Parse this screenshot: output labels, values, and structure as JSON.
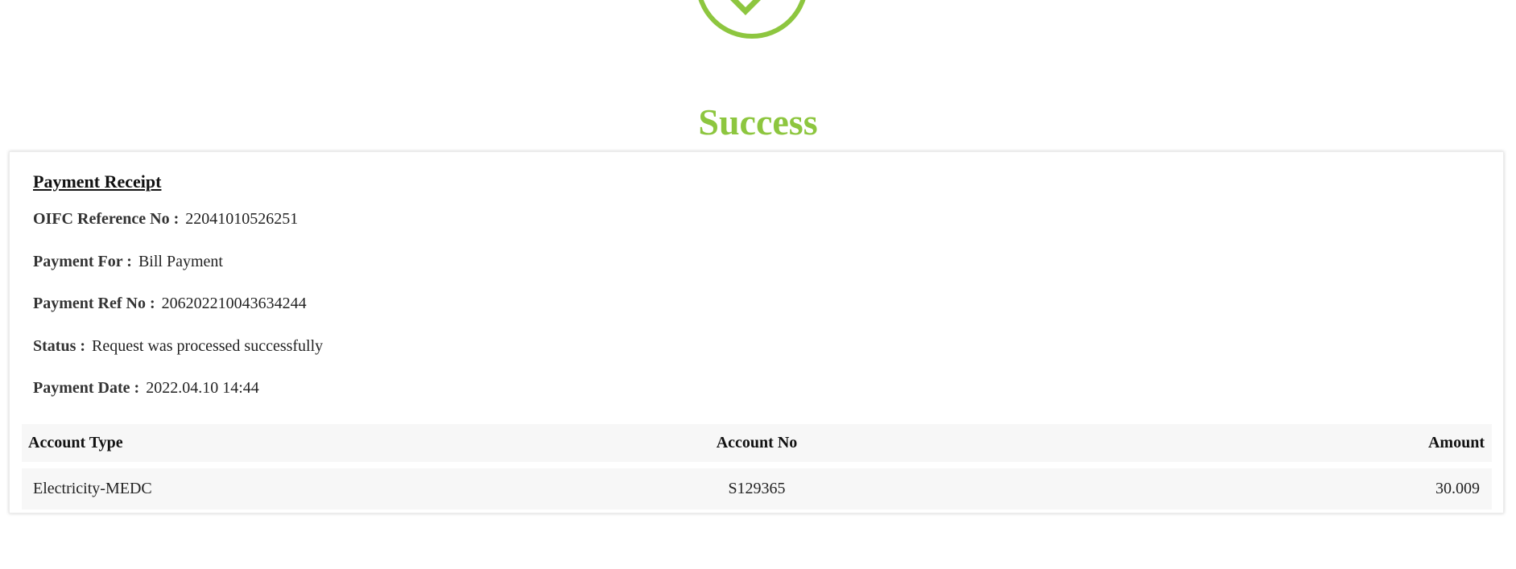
{
  "colors": {
    "accent": "#8dc63f",
    "row_background": "#f7f7f7"
  },
  "status_icon": "check-circle-icon",
  "title": "Success",
  "receipt": {
    "heading": "Payment Receipt",
    "fields": [
      {
        "label": "OIFC Reference No :",
        "value": "22041010526251"
      },
      {
        "label": "Payment For :",
        "value": "Bill Payment"
      },
      {
        "label": "Payment Ref No :",
        "value": "206202210043634244"
      },
      {
        "label": "Status :",
        "value": "Request was processed successfully"
      },
      {
        "label": "Payment Date :",
        "value": "2022.04.10 14:44"
      }
    ]
  },
  "table": {
    "headers": [
      "Account Type",
      "Account No",
      "Amount"
    ],
    "rows": [
      [
        "Electricity-MEDC",
        "S129365",
        "30.009"
      ]
    ]
  }
}
